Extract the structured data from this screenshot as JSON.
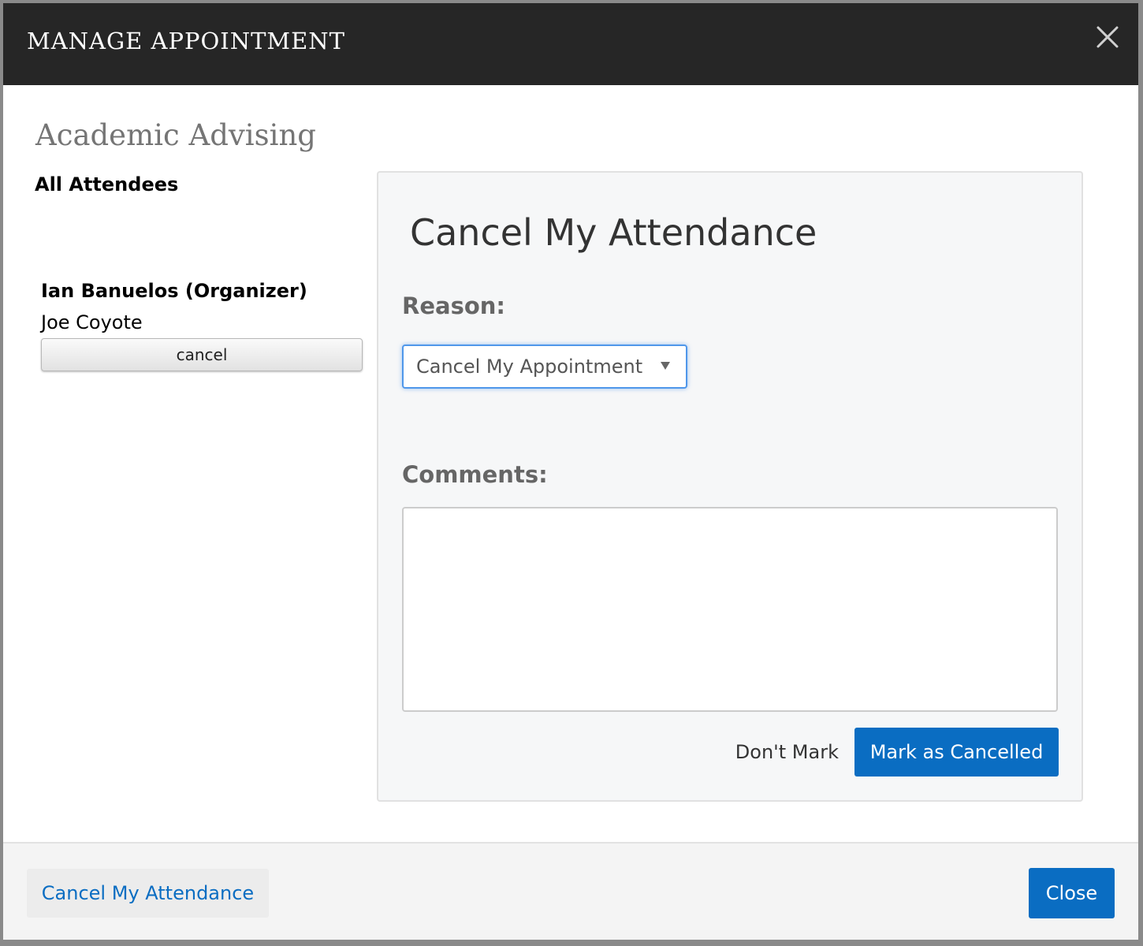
{
  "modal": {
    "title": "MANAGE APPOINTMENT",
    "close_icon": "close-icon"
  },
  "appointment": {
    "title": "Academic Advising"
  },
  "attendees": {
    "heading": "All Attendees",
    "organizer": "Ian Banuelos (Organizer)",
    "items": [
      {
        "name": "Joe Coyote",
        "action_label": "cancel"
      }
    ]
  },
  "cancel_panel": {
    "title": "Cancel My Attendance",
    "reason_label": "Reason:",
    "reason_selected": "Cancel My Appointment",
    "reason_icon": "chevron-down-icon",
    "comments_label": "Comments:",
    "comments_value": "",
    "dont_mark_label": "Don't Mark",
    "mark_cancelled_label": "Mark as Cancelled"
  },
  "footer": {
    "cancel_attendance_label": "Cancel My Attendance",
    "close_label": "Close"
  },
  "colors": {
    "header_bg": "#262626",
    "primary": "#0a6dc2",
    "panel_bg": "#f6f7f8",
    "focus_ring": "#4f97ea"
  }
}
